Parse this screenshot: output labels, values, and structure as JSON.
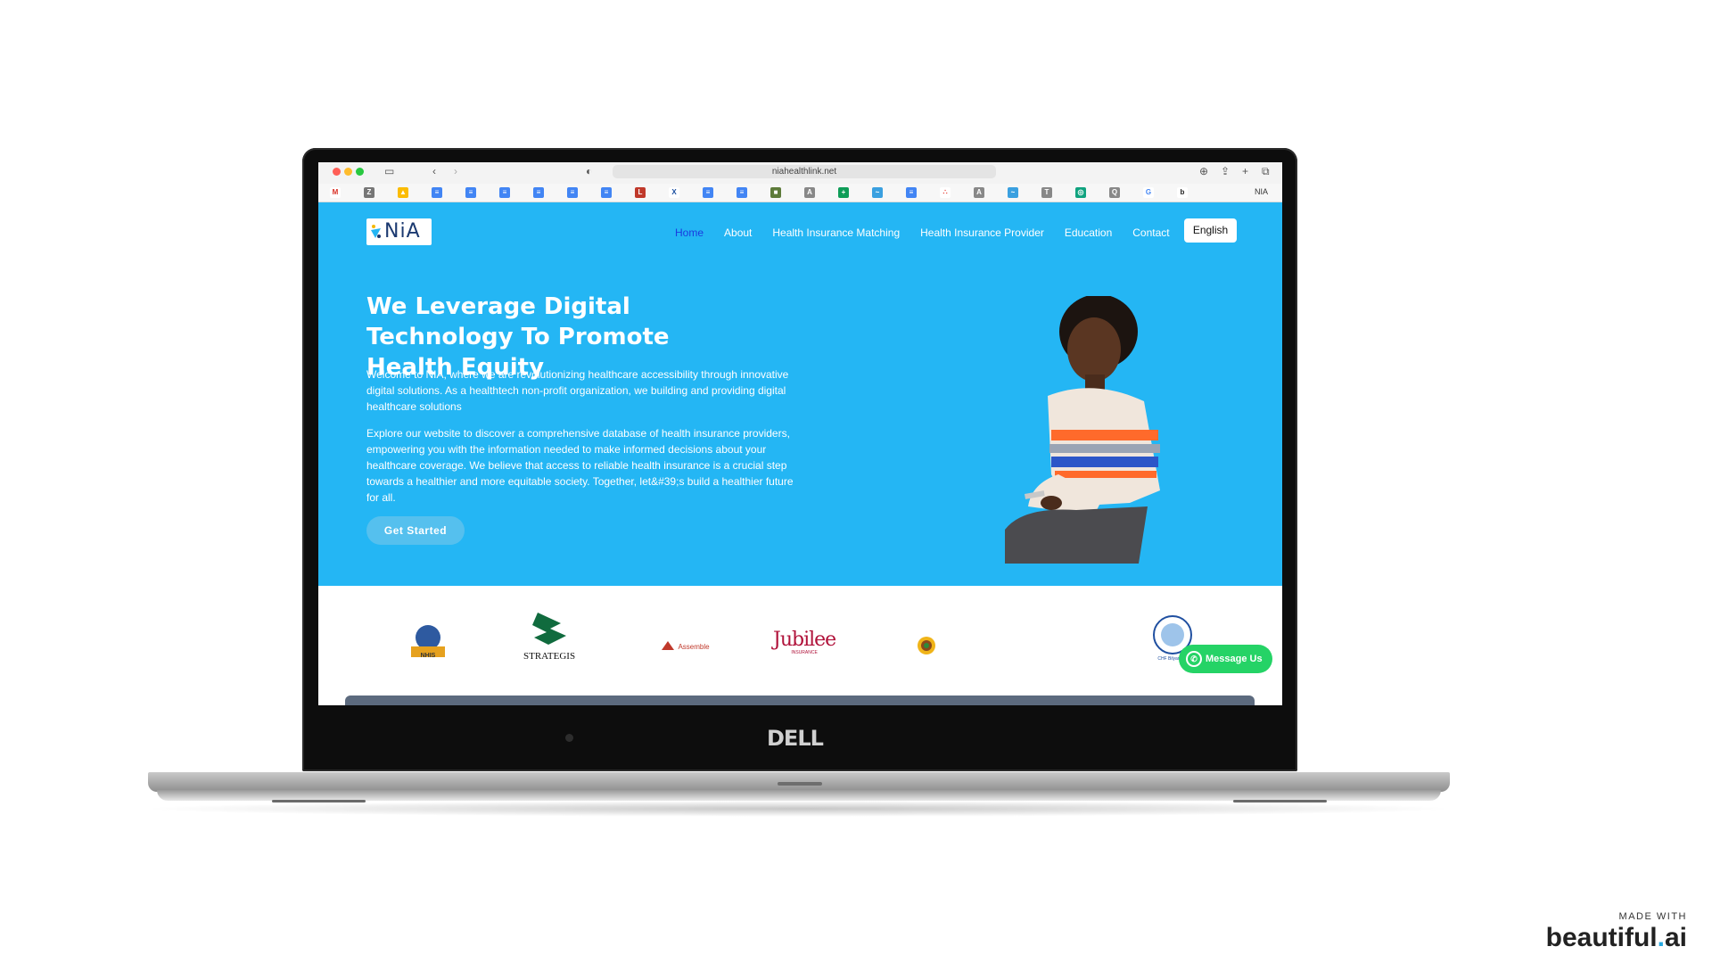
{
  "browser": {
    "url": "niahealthlink.net",
    "tab_label": "NIA"
  },
  "site": {
    "logo_text": "NiA",
    "nav": [
      "Home",
      "About",
      "Health Insurance Matching",
      "Health Insurance Provider",
      "Education",
      "Contact"
    ],
    "nav_active": "Home",
    "language_button": "English",
    "hero_title": "We Leverage Digital Technology To Promote Health Equity",
    "paragraph_1": "Welcome to NIA, where we are revolutionizing healthcare accessibility through innovative digital solutions. As a healthtech non-profit organization, we building and providing digital healthcare solutions",
    "paragraph_2": "Explore our website to discover a comprehensive database of health insurance providers, empowering you with the information needed to make informed decisions about your healthcare coverage. We believe that access to reliable health insurance is a crucial step towards a healthier and more equitable society. Together, let&#39;s build a healthier future for all.",
    "cta_label": "Get Started",
    "partners": [
      "NHIS",
      "STRATEGIS",
      "Assemble",
      "Jubilee",
      "INSURANCE",
      "CHF Bilyaminu"
    ],
    "whatsapp_label": "Message Us"
  },
  "laptop": {
    "brand": "DELL"
  },
  "watermark": {
    "made_with": "MADE WITH",
    "brand_main": "beautiful",
    "brand_dot": ".",
    "brand_tld": "ai"
  },
  "colors": {
    "hero_bg": "#24b6f4",
    "nav_active": "#1a3bdf",
    "whatsapp": "#25d366",
    "logo_navy": "#1b3970"
  }
}
